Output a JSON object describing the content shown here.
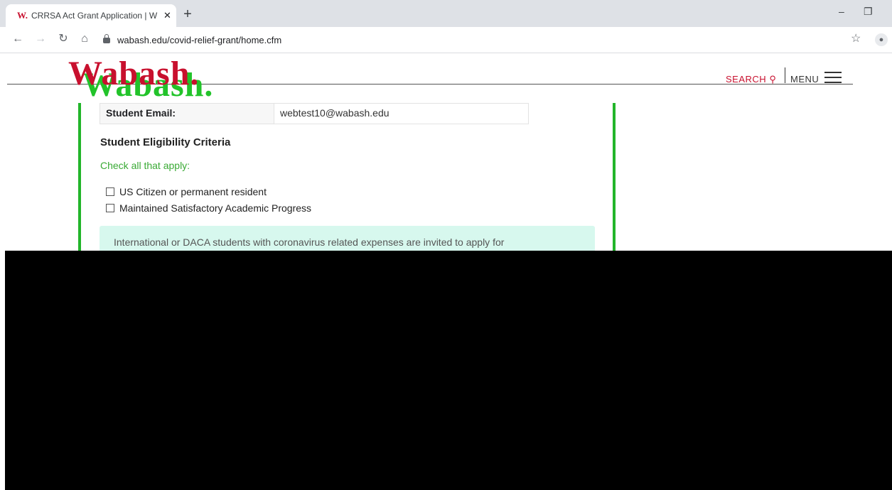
{
  "browser": {
    "tab_title": "CRRSA Act Grant Application | W",
    "favicon": "W.",
    "url": "wabash.edu/covid-relief-grant/home.cfm"
  },
  "header": {
    "logo_text": "Wabash.",
    "search_label": "SEARCH",
    "menu_label": "MENU"
  },
  "form": {
    "email_label": "Student Email:",
    "email_value": "webtest10@wabash.edu",
    "section_title": "Student Eligibility Criteria",
    "hint": "Check all that apply:",
    "criteria": [
      "US Citizen or permanent resident",
      "Maintained Satisfactory Academic Progress"
    ],
    "notice": "International or DACA students with coronavirus related expenses are invited to apply for"
  },
  "colors": {
    "brand_red": "#c8102e",
    "brand_green": "#22b52a",
    "notice_bg": "#d7f8ee"
  }
}
